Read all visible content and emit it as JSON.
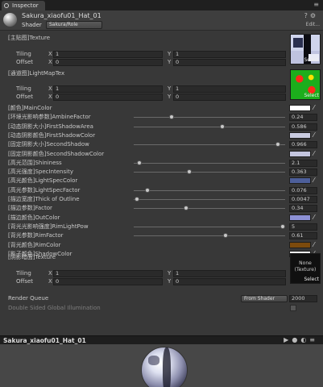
{
  "window": {
    "tab_label": "Inspector",
    "menu_icon": "menu-icon"
  },
  "material": {
    "name": "Sakura_xiaofu01_Hat_01",
    "shader_label": "Shader",
    "shader_value": "Sakura/Role",
    "edit_label": "Edit..."
  },
  "textures": [
    {
      "label": "[主贴图]Texture",
      "tiling_label": "Tiling",
      "offset_label": "Offset",
      "tiling_x": "1",
      "tiling_y": "1",
      "offset_x": "0",
      "offset_y": "0",
      "select": "Select"
    },
    {
      "label": "[通道图]LightMapTex",
      "tiling_label": "Tiling",
      "offset_label": "Offset",
      "tiling_x": "1",
      "tiling_y": "1",
      "offset_x": "0",
      "offset_y": "0",
      "select": "Select"
    },
    {
      "label": "[阴影暗面]Texture",
      "tiling_label": "Tiling",
      "offset_label": "Offset",
      "tiling_x": "1",
      "tiling_y": "1",
      "offset_x": "0",
      "offset_y": "0",
      "select": "Select",
      "none_text": "None (Texture)"
    }
  ],
  "vector_axes": {
    "x": "X",
    "y": "Y"
  },
  "properties": [
    {
      "label": "[颜色]MainColor",
      "kind": "color",
      "color": "#ffffff"
    },
    {
      "label": "[环境光影响参数]AmbineFactor",
      "kind": "slider",
      "value": "0.24",
      "fraction": 0.24
    },
    {
      "label": "[动态阴影大小]FirstShadowArea",
      "kind": "slider",
      "value": "0.586",
      "fraction": 0.586
    },
    {
      "label": "[动态阴影颜色]FirstShadowColor",
      "kind": "color",
      "color": "#c9cbe0"
    },
    {
      "label": "[固定阴影大小]SecondShadow",
      "kind": "slider",
      "value": "0.966",
      "fraction": 0.966
    },
    {
      "label": "[固定阴影颜色]SecondShadowColor",
      "kind": "color",
      "color": "#c3c5de"
    },
    {
      "label": "[高光范围]Shininess",
      "kind": "slider",
      "value": "2.1",
      "fraction": 0.02
    },
    {
      "label": "[高光强度]SpecIntensity",
      "kind": "slider",
      "value": "0.363",
      "fraction": 0.363
    },
    {
      "label": "[高光颜色]LightSpecColor",
      "kind": "color",
      "color": "#4d5f9a"
    },
    {
      "label": "[高光参数]LightSpecFactor",
      "kind": "slider",
      "value": "0.076",
      "fraction": 0.076
    },
    {
      "label": "[描边宽度]Thick of Outline",
      "kind": "slider",
      "value": "0.0047",
      "fraction": 0.0047
    },
    {
      "label": "[描边参数]Factor",
      "kind": "slider",
      "value": "0.34",
      "fraction": 0.34
    },
    {
      "label": "[描边颜色]OutColor",
      "kind": "color",
      "color": "#8d91d5"
    },
    {
      "label": "[背光光影响强度]RimLightPow",
      "kind": "slider",
      "value": "5",
      "fraction": 1.0
    },
    {
      "label": "[背光参数]RimFactor",
      "kind": "slider",
      "value": "0.61",
      "fraction": 0.61
    },
    {
      "label": "[背光颜色]RimColor",
      "kind": "color",
      "color": "#7c4a0c"
    },
    {
      "label": "[影子颜色]ShadowColor",
      "kind": "color",
      "color": "#f0f0f0"
    }
  ],
  "render_queue": {
    "label": "Render Queue",
    "mode": "From Shader",
    "value": "2000"
  },
  "double_sided": {
    "label": "Double Sided Global Illumination"
  },
  "preview": {
    "title": "Sakura_xiaofu01_Hat_01"
  }
}
